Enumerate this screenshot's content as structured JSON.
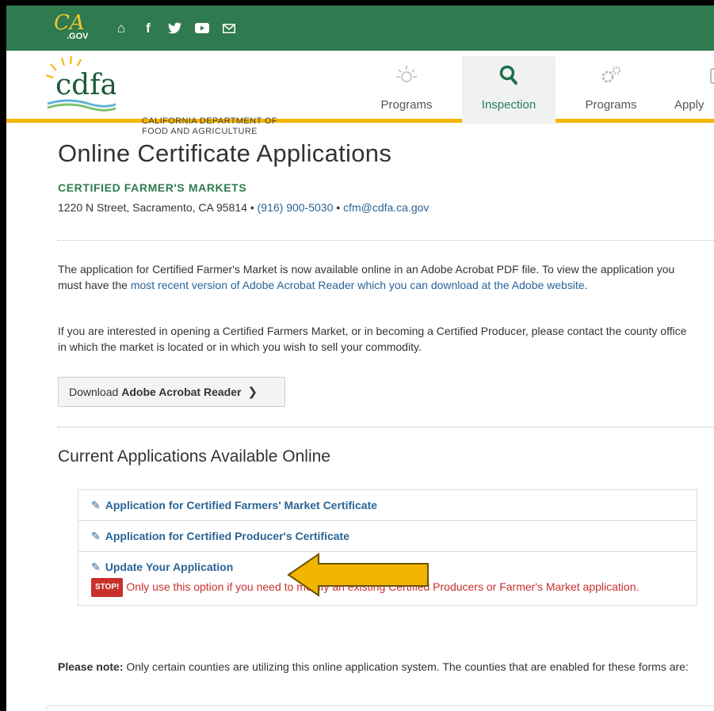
{
  "topbar": {
    "ca_logo_text": "CA",
    "gov_text": ".GOV",
    "icons": [
      "home-icon",
      "facebook-icon",
      "twitter-icon",
      "youtube-icon",
      "email-icon"
    ]
  },
  "header": {
    "logo_text": "cdfa",
    "dept_line1": "CALIFORNIA DEPARTMENT OF",
    "dept_line2": "FOOD AND AGRICULTURE",
    "nav": [
      {
        "label": "Programs",
        "icon": "sun-icon"
      },
      {
        "label": "Inspection",
        "icon": "search-icon",
        "active": true
      },
      {
        "label": "Programs",
        "icon": "gears-icon"
      },
      {
        "label": "Apply",
        "icon": "form-icon"
      }
    ]
  },
  "page": {
    "title": "Online Certificate Applications",
    "subtitle": "CERTIFIED FARMER'S MARKETS",
    "address": "1220 N Street, Sacramento, CA 95814",
    "phone": "(916) 900-5030",
    "email": "cfm@cdfa.ca.gov",
    "para1_a": "The application for Certified Farmer's Market is now available online in an Adobe Acrobat PDF file. To view the application you must have the ",
    "para1_link": "most recent version of Adobe Acrobat Reader which you can download at the Adobe website",
    "para1_end": ".",
    "para2": "If you are interested in opening a Certified Farmers Market, or in becoming a Certified Producer, please contact the county office in which the market is located or in which you wish to sell your commodity.",
    "download_prefix": "Download",
    "download_bold": "Adobe Acrobat Reader",
    "section_title": "Current Applications Available Online",
    "apps": [
      "Application for Certified Farmers' Market Certificate",
      "Application for Certified Producer's Certificate",
      "Update Your Application"
    ],
    "stop_badge": "STOP!",
    "stop_text": "Only use this option if you need to modify an existing Certified Producers or Farmer's Market application.",
    "note_bold": "Please note:",
    "note_text": " Only certain counties are utilizing this online application system. The counties that are enabled for these forms are:"
  },
  "colors": {
    "topbar": "#2f7a4e",
    "accent_yellow": "#f5b400",
    "link": "#2a6496",
    "stop_red": "#c9302c",
    "arrow": "#f2b600"
  }
}
